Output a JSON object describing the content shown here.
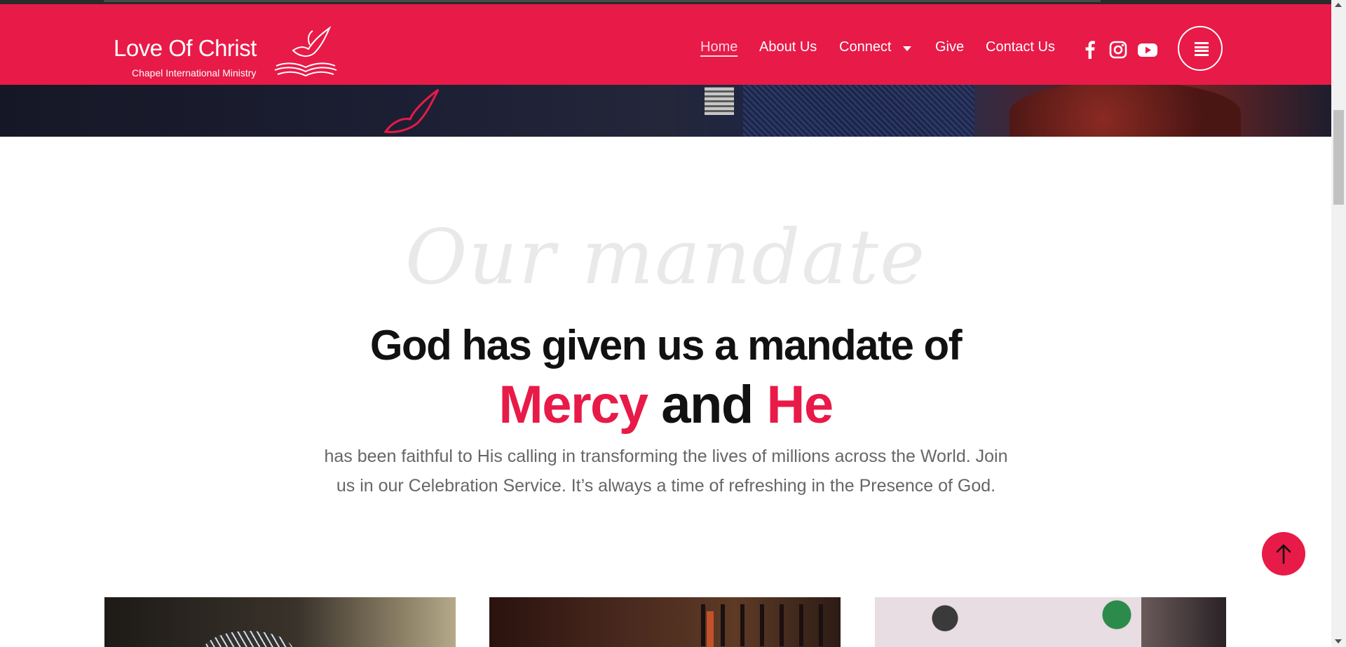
{
  "brand": {
    "name": "Love Of Christ",
    "subtitle": "Chapel International Ministry"
  },
  "nav": {
    "items": [
      {
        "label": "Home",
        "active": true
      },
      {
        "label": "About Us"
      },
      {
        "label": "Connect",
        "has_dropdown": true
      },
      {
        "label": "Give"
      },
      {
        "label": "Contact Us"
      }
    ],
    "social": [
      "facebook-icon",
      "instagram-icon",
      "youtube-icon"
    ],
    "menu_icon": "hamburger-menu-icon"
  },
  "mandate": {
    "script_title": "Our mandate",
    "headline_line1": "God has given us a mandate of",
    "headline_word1": "Mercy",
    "headline_word2": "and",
    "headline_word3": "He",
    "body": "has been faithful to His calling in transforming the lives of millions across the World. Join us in our Celebration Service. It’s always a time of refreshing in the Presence of God."
  },
  "to_top_icon": "arrow-up-icon",
  "colors": {
    "accent": "#e81a48",
    "heading": "#111111",
    "body_text": "#666666",
    "script_text": "#e9e9e9"
  }
}
